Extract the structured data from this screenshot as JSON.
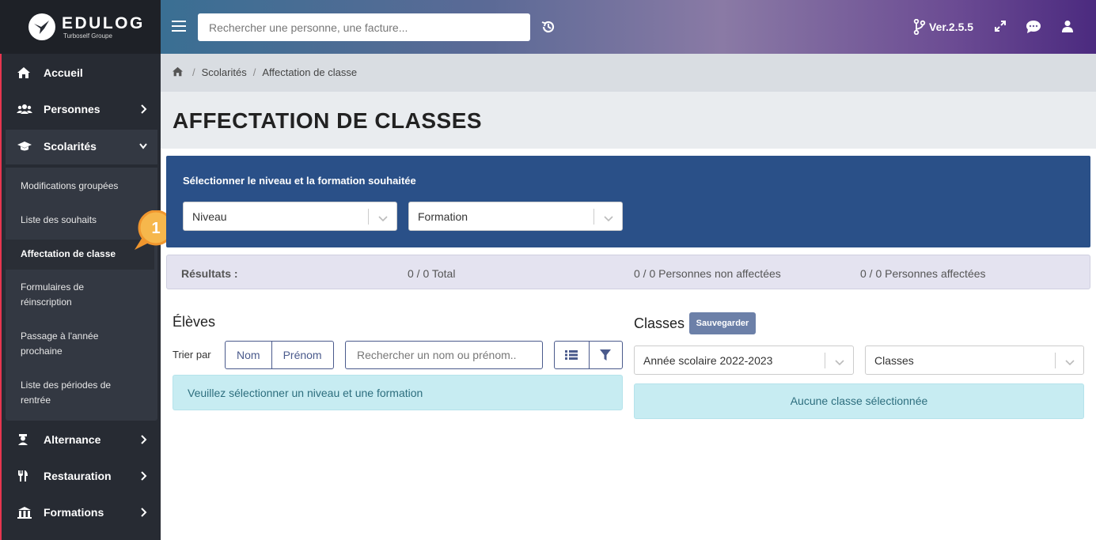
{
  "app": {
    "brand": "EDULOG",
    "brand_sub": "Turboself Groupe",
    "version": "Ver.2.5.5"
  },
  "colors": {
    "sidebar_bg": "#272b33",
    "accent": "#e7354f",
    "panel_blue": "#2a5088",
    "info_bg": "#c7ecf2",
    "callout_orange": "#f0962e"
  },
  "header": {
    "search_placeholder": "Rechercher une personne, une facture...",
    "icons": [
      "menu-icon",
      "history-icon",
      "git-branch-icon",
      "expand-icon",
      "chat-icon",
      "user-icon"
    ]
  },
  "sidebar": {
    "items": [
      {
        "label": "Accueil",
        "icon": "home-icon"
      },
      {
        "label": "Personnes",
        "icon": "users-icon"
      },
      {
        "label": "Scolarités",
        "icon": "graduation-cap-icon"
      },
      {
        "label": "Alternance",
        "icon": "worker-icon"
      },
      {
        "label": "Restauration",
        "icon": "utensils-icon"
      },
      {
        "label": "Formations",
        "icon": "building-icon"
      }
    ],
    "submenu": [
      {
        "label": "Modifications groupées"
      },
      {
        "label": "Liste des souhaits"
      },
      {
        "label": "Affectation de classe"
      },
      {
        "label": "Formulaires de réinscription"
      },
      {
        "label": "Passage à l'année prochaine"
      },
      {
        "label": "Liste des périodes de rentrée"
      }
    ]
  },
  "callout": {
    "number": "1"
  },
  "breadcrumb": {
    "items": [
      "Scolarités",
      "Affectation de classe"
    ],
    "separator": "/"
  },
  "page": {
    "title": "AFFECTATION DE CLASSES"
  },
  "selection_panel": {
    "title": "Sélectionner le niveau et la formation souhaitée",
    "niveau": "Niveau",
    "formation": "Formation"
  },
  "results": {
    "label": "Résultats :",
    "total": "0 / 0 Total",
    "non_affectees": "0 / 0 Personnes non affectées",
    "affectees": "0 / 0 Personnes affectées"
  },
  "eleves": {
    "title": "Élèves",
    "sort_label": "Trier par",
    "sort_nom": "Nom",
    "sort_prenom": "Prénom",
    "search_placeholder": "Rechercher un nom ou prénom..",
    "info": "Veuillez sélectionner un niveau et une formation"
  },
  "classes": {
    "title": "Classes",
    "save_label": "Sauvegarder",
    "year_select": "Année scolaire 2022-2023",
    "classes_select": "Classes",
    "info": "Aucune classe sélectionnée"
  }
}
